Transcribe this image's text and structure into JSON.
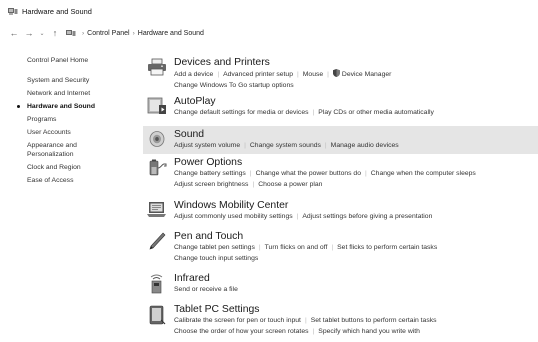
{
  "window": {
    "title": "Hardware and Sound"
  },
  "nav": {
    "back": "←",
    "forward": "→",
    "recent": "⌄",
    "up": "↑",
    "sep": "›",
    "breadcrumb": [
      "Control Panel",
      "Hardware and Sound"
    ]
  },
  "sidebar": {
    "home": "Control Panel Home",
    "items": [
      "System and Security",
      "Network and Internet",
      "Hardware and Sound",
      "Programs",
      "User Accounts",
      "Appearance and Personalization",
      "Clock and Region",
      "Ease of Access"
    ],
    "current_index": 2
  },
  "categories": [
    {
      "title": "Devices and Printers",
      "icon": "printer-icon",
      "lines": [
        [
          "Add a device",
          "Advanced printer setup",
          "Mouse",
          "Device Manager"
        ],
        [
          "Change Windows To Go startup options"
        ]
      ]
    },
    {
      "title": "AutoPlay",
      "icon": "autoplay-icon",
      "lines": [
        [
          "Change default settings for media or devices",
          "Play CDs or other media automatically"
        ]
      ]
    },
    {
      "title": "Sound",
      "icon": "speaker-icon",
      "lines": [
        [
          "Adjust system volume",
          "Change system sounds",
          "Manage audio devices"
        ]
      ]
    },
    {
      "title": "Power Options",
      "icon": "power-options-icon",
      "lines": [
        [
          "Change battery settings",
          "Change what the power buttons do",
          "Change when the computer sleeps"
        ],
        [
          "Adjust screen brightness",
          "Choose a power plan"
        ]
      ]
    },
    {
      "title": "Windows Mobility Center",
      "icon": "mobility-center-icon",
      "lines": [
        [
          "Adjust commonly used mobility settings",
          "Adjust settings before giving a presentation"
        ]
      ]
    },
    {
      "title": "Pen and Touch",
      "icon": "pen-icon",
      "lines": [
        [
          "Change tablet pen settings",
          "Turn flicks on and off",
          "Set flicks to perform certain tasks"
        ],
        [
          "Change touch input settings"
        ]
      ]
    },
    {
      "title": "Infrared",
      "icon": "infrared-icon",
      "lines": [
        [
          "Send or receive a file"
        ]
      ]
    },
    {
      "title": "Tablet PC Settings",
      "icon": "tablet-pc-icon",
      "lines": [
        [
          "Calibrate the screen for pen or touch input",
          "Set tablet buttons to perform certain tasks"
        ],
        [
          "Choose the order of how your screen rotates",
          "Specify which hand you write with"
        ]
      ]
    }
  ],
  "colors": {
    "highlight": "#e5e5e5",
    "text": "#333333"
  }
}
